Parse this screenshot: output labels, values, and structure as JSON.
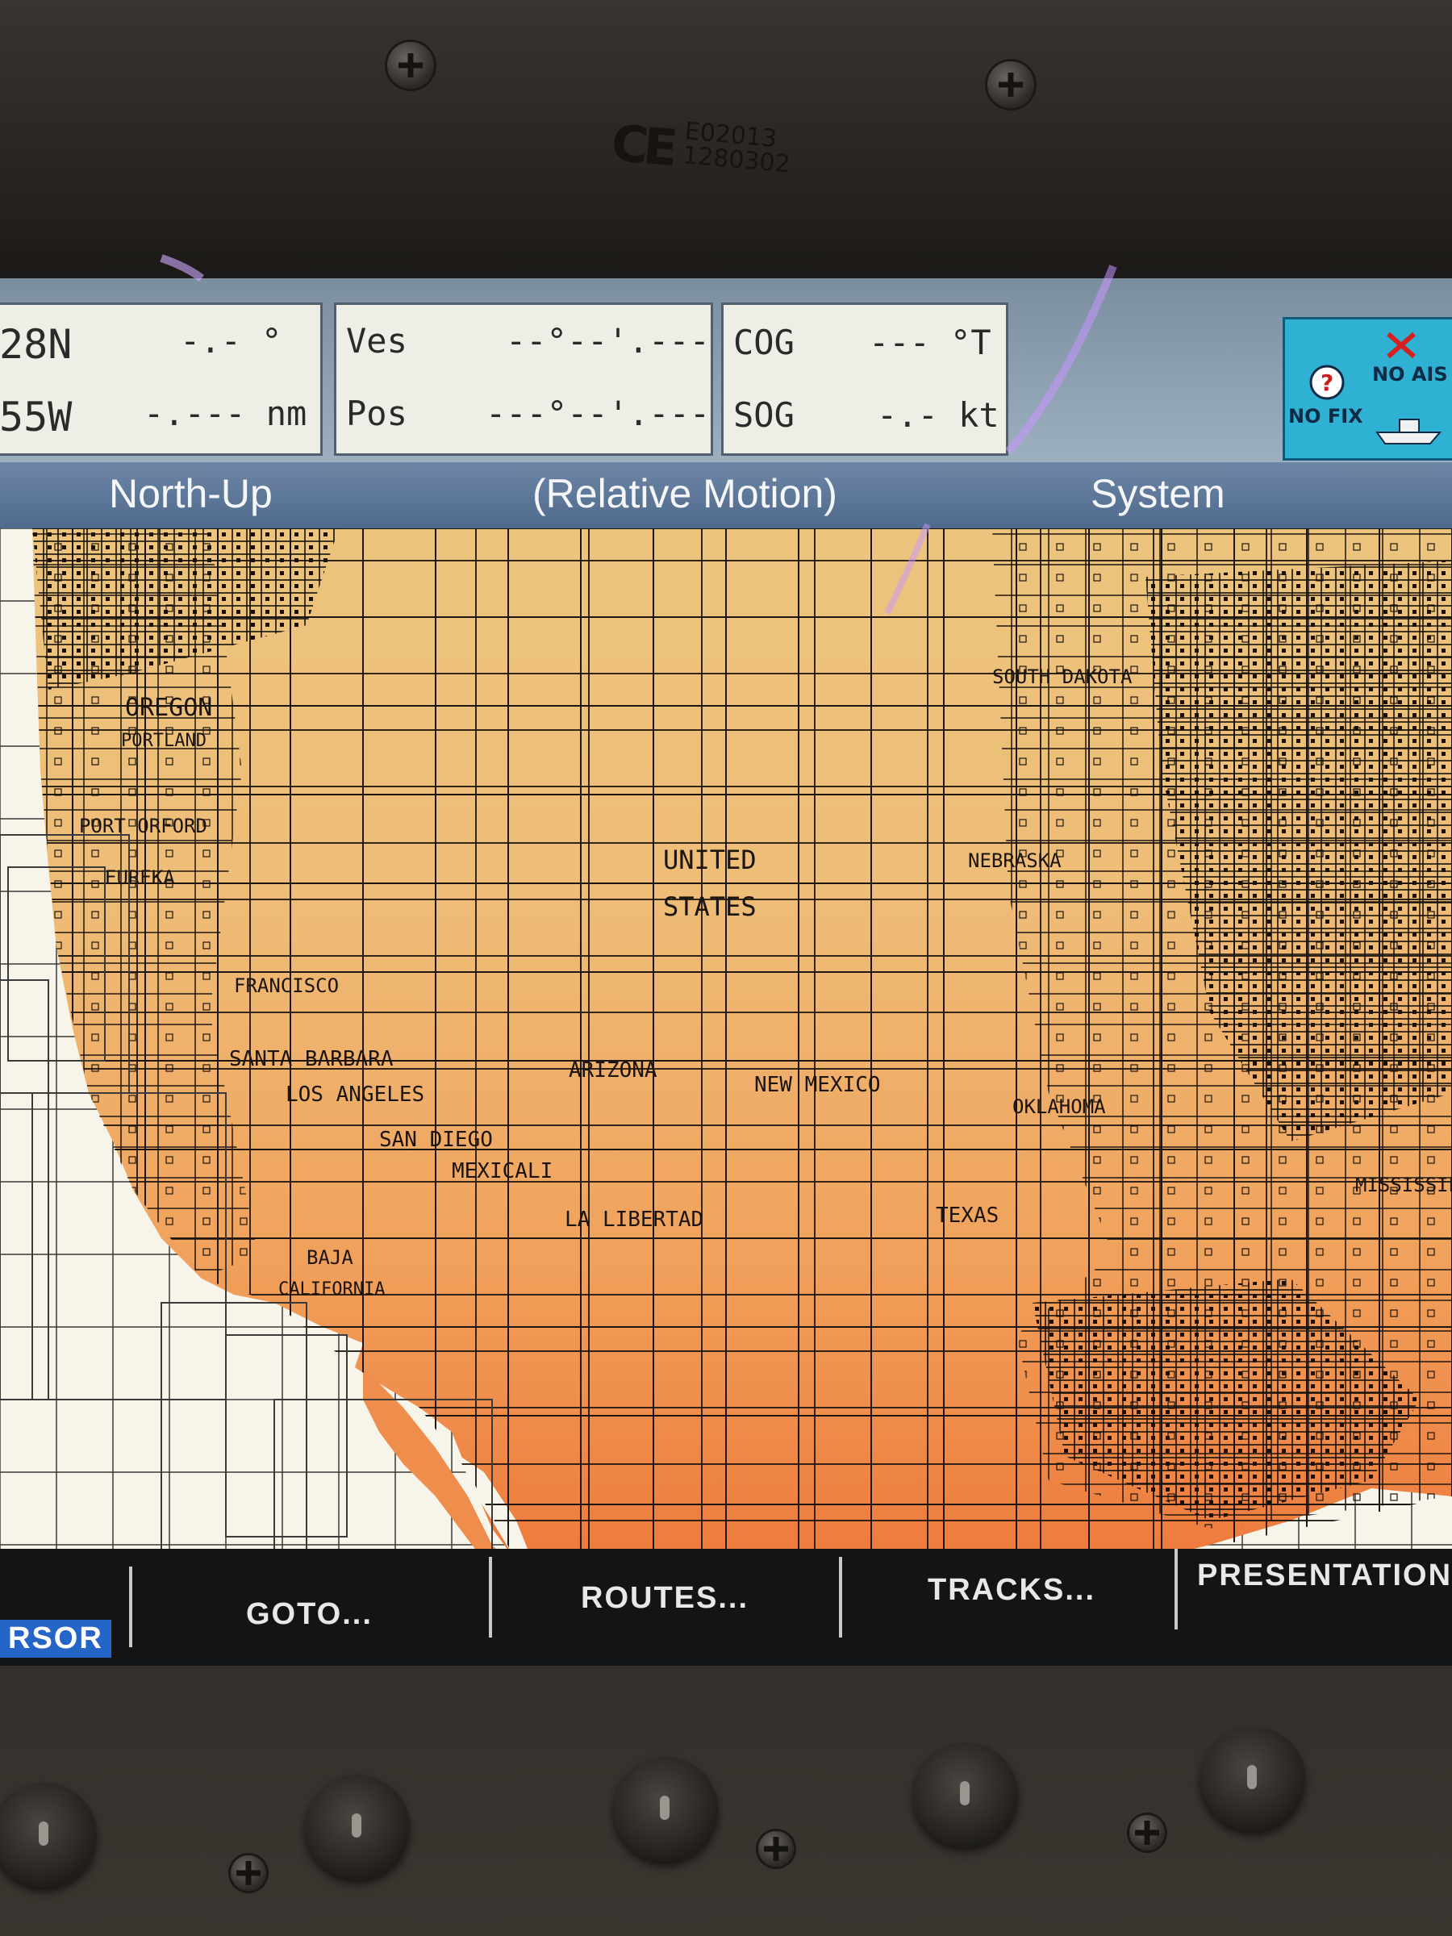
{
  "device": {
    "ce_mark": "CE",
    "ce_code_1": "E02013",
    "ce_code_2": "1280302"
  },
  "databar": {
    "cursor_panel": {
      "lat_suffix": "28N",
      "lon_suffix": "55W",
      "bearing": "-.- °",
      "range": "-.--- nm"
    },
    "vessel_panel": {
      "label_1": "Ves",
      "label_2": "Pos",
      "value_1": "--°--'.---",
      "value_2": "---°--'.---"
    },
    "course_panel": {
      "cog_label": "COG",
      "cog_value": "--- °T",
      "sog_label": "SOG",
      "sog_value": "-.- kt"
    },
    "status": {
      "no_fix": "NO FIX",
      "no_ais": "NO AIS"
    }
  },
  "titlebar": {
    "orientation": "North-Up",
    "motion": "(Relative Motion)",
    "mode": "System"
  },
  "map": {
    "labels": [
      "OREGON",
      "PORTLAND",
      "PORT ORFORD",
      "EUREKA",
      "UNITED",
      "STATES",
      "NEBRASKA",
      "SOUTH DAKOTA",
      "FRANCISCO",
      "SANTA BARBARA",
      "LOS ANGELES",
      "SAN DIEGO",
      "ARIZONA",
      "NEW MEXICO",
      "MEXICALI",
      "LA LIBERTAD",
      "BAJA",
      "CALIFORNIA",
      "TEXAS",
      "OKLAHOMA",
      "MISSISSIPPI"
    ]
  },
  "softkeys": {
    "cursor": "RSOR",
    "goto": "GOTO...",
    "routes": "ROUTES...",
    "tracks": "TRACKS...",
    "presentation": "PRESENTATION"
  }
}
